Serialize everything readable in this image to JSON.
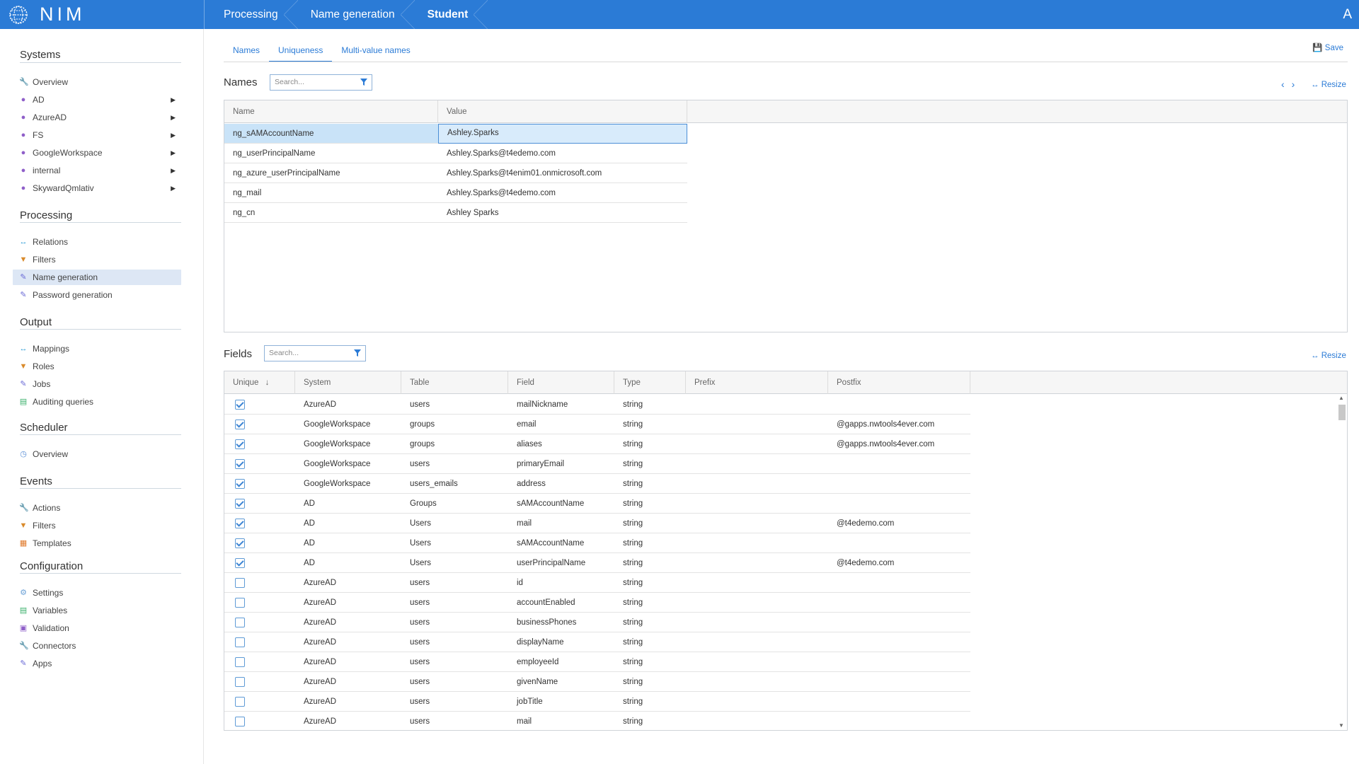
{
  "app": {
    "title": "NIM",
    "avatar": "A"
  },
  "breadcrumbs": [
    "Processing",
    "Name generation",
    "Student"
  ],
  "sidebar": {
    "sections": [
      {
        "title": "Systems",
        "items": [
          {
            "label": "Overview",
            "icon": "wrench-icon",
            "arrow": false
          },
          {
            "label": "AD",
            "icon": "users-icon",
            "arrow": true
          },
          {
            "label": "AzureAD",
            "icon": "users-icon",
            "arrow": true
          },
          {
            "label": "FS",
            "icon": "users-icon",
            "arrow": true
          },
          {
            "label": "GoogleWorkspace",
            "icon": "users-icon",
            "arrow": true
          },
          {
            "label": "internal",
            "icon": "users-icon",
            "arrow": true
          },
          {
            "label": "SkywardQmlativ",
            "icon": "users-icon",
            "arrow": true
          }
        ]
      },
      {
        "title": "Processing",
        "items": [
          {
            "label": "Relations",
            "icon": "relations-icon"
          },
          {
            "label": "Filters",
            "icon": "filter-icon"
          },
          {
            "label": "Name generation",
            "icon": "edit-icon",
            "active": true
          },
          {
            "label": "Password generation",
            "icon": "edit-icon"
          }
        ]
      },
      {
        "title": "Output",
        "items": [
          {
            "label": "Mappings",
            "icon": "relations-icon"
          },
          {
            "label": "Roles",
            "icon": "filter-icon"
          },
          {
            "label": "Jobs",
            "icon": "edit-icon"
          },
          {
            "label": "Auditing queries",
            "icon": "document-icon"
          }
        ]
      },
      {
        "title": "Scheduler",
        "items": [
          {
            "label": "Overview",
            "icon": "clock-icon"
          }
        ]
      },
      {
        "title": "Events",
        "items": [
          {
            "label": "Actions",
            "icon": "wrench-icon"
          },
          {
            "label": "Filters",
            "icon": "filter-icon"
          },
          {
            "label": "Templates",
            "icon": "template-icon"
          }
        ]
      },
      {
        "title": "Configuration",
        "items": [
          {
            "label": "Settings",
            "icon": "gear-icon"
          },
          {
            "label": "Variables",
            "icon": "document-icon"
          },
          {
            "label": "Validation",
            "icon": "validation-icon"
          },
          {
            "label": "Connectors",
            "icon": "wrench-icon"
          },
          {
            "label": "Apps",
            "icon": "edit-icon"
          }
        ]
      }
    ]
  },
  "tabs": [
    "Names",
    "Uniqueness",
    "Multi-value names"
  ],
  "active_tab": "Uniqueness",
  "save_label": "Save",
  "names_panel": {
    "title": "Names",
    "search_placeholder": "Search...",
    "resize_label": "Resize",
    "columns": [
      "Name",
      "Value"
    ],
    "rows": [
      [
        "ng_sAMAccountName",
        "Ashley.Sparks"
      ],
      [
        "ng_userPrincipalName",
        "Ashley.Sparks@t4edemo.com"
      ],
      [
        "ng_azure_userPrincipalName",
        "Ashley.Sparks@t4enim01.onmicrosoft.com"
      ],
      [
        "ng_mail",
        "Ashley.Sparks@t4edemo.com"
      ],
      [
        "ng_cn",
        "Ashley Sparks"
      ]
    ]
  },
  "fields_panel": {
    "title": "Fields",
    "search_placeholder": "Search...",
    "resize_label": "Resize",
    "columns": [
      "Unique",
      "System",
      "Table",
      "Field",
      "Type",
      "Prefix",
      "Postfix"
    ],
    "rows": [
      [
        true,
        "AzureAD",
        "users",
        "mailNickname",
        "string",
        "",
        ""
      ],
      [
        true,
        "GoogleWorkspace",
        "groups",
        "email",
        "string",
        "",
        "@gapps.nwtools4ever.com"
      ],
      [
        true,
        "GoogleWorkspace",
        "groups",
        "aliases",
        "string",
        "",
        "@gapps.nwtools4ever.com"
      ],
      [
        true,
        "GoogleWorkspace",
        "users",
        "primaryEmail",
        "string",
        "",
        ""
      ],
      [
        true,
        "GoogleWorkspace",
        "users_emails",
        "address",
        "string",
        "",
        ""
      ],
      [
        true,
        "AD",
        "Groups",
        "sAMAccountName",
        "string",
        "",
        ""
      ],
      [
        true,
        "AD",
        "Users",
        "mail",
        "string",
        "",
        "@t4edemo.com"
      ],
      [
        true,
        "AD",
        "Users",
        "sAMAccountName",
        "string",
        "",
        ""
      ],
      [
        true,
        "AD",
        "Users",
        "userPrincipalName",
        "string",
        "",
        "@t4edemo.com"
      ],
      [
        false,
        "AzureAD",
        "users",
        "id",
        "string",
        "",
        ""
      ],
      [
        false,
        "AzureAD",
        "users",
        "accountEnabled",
        "string",
        "",
        ""
      ],
      [
        false,
        "AzureAD",
        "users",
        "businessPhones",
        "string",
        "",
        ""
      ],
      [
        false,
        "AzureAD",
        "users",
        "displayName",
        "string",
        "",
        ""
      ],
      [
        false,
        "AzureAD",
        "users",
        "employeeId",
        "string",
        "",
        ""
      ],
      [
        false,
        "AzureAD",
        "users",
        "givenName",
        "string",
        "",
        ""
      ],
      [
        false,
        "AzureAD",
        "users",
        "jobTitle",
        "string",
        "",
        ""
      ],
      [
        false,
        "AzureAD",
        "users",
        "mail",
        "string",
        "",
        ""
      ]
    ]
  },
  "colors": {
    "brand": "#2b7bd6",
    "selected_row": "#c9e3f8",
    "active_nav": "#dde7f5"
  }
}
